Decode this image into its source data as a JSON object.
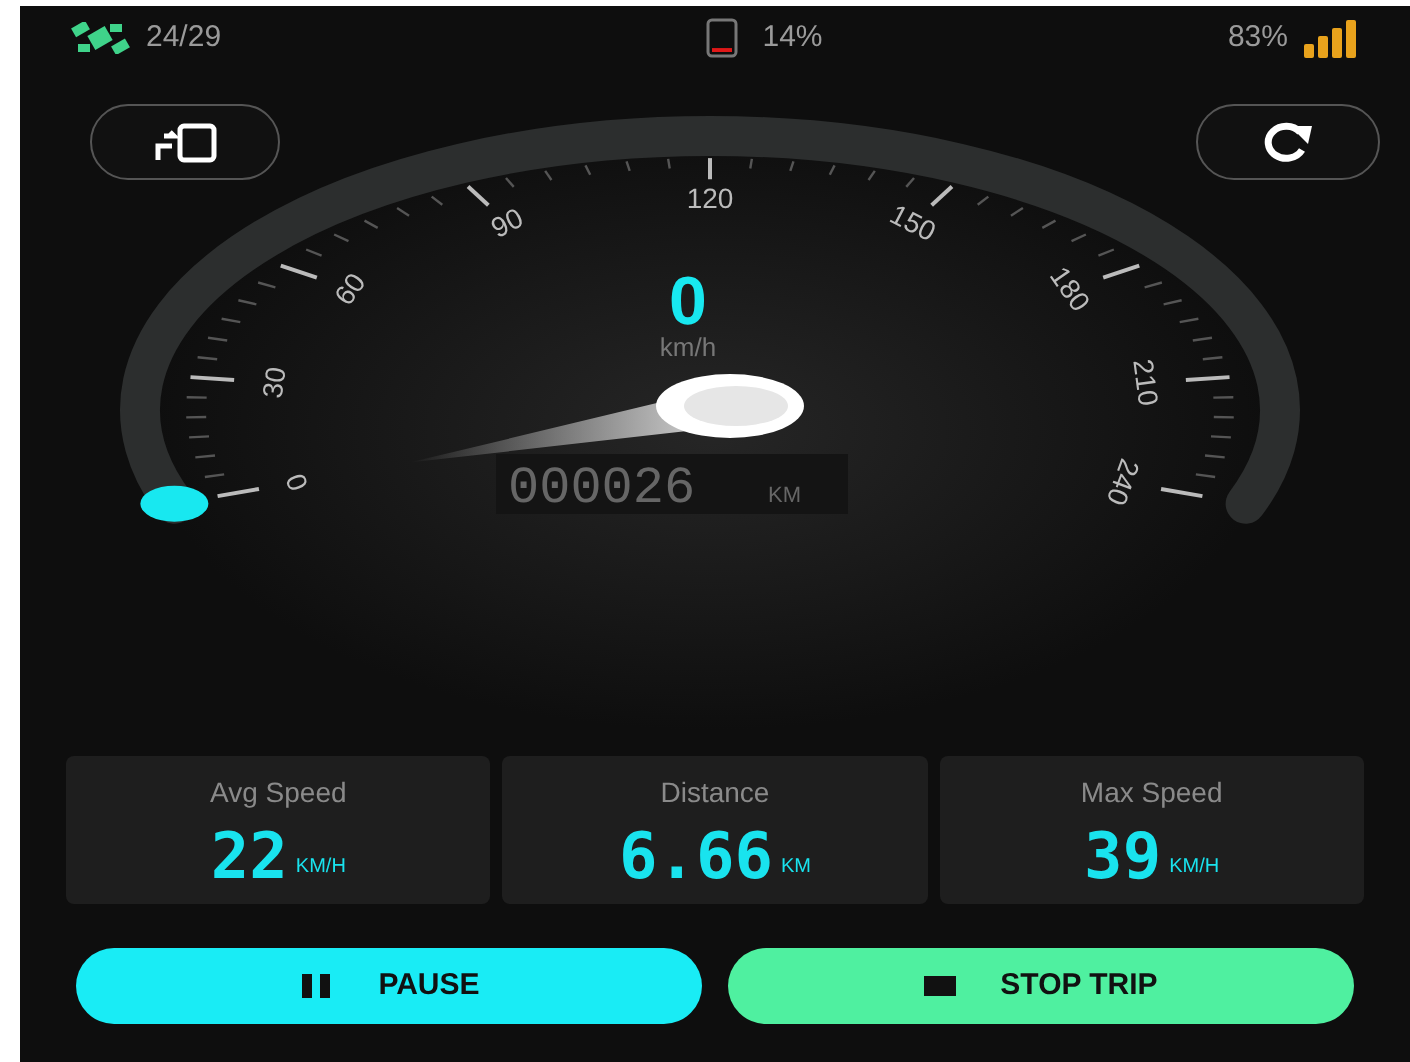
{
  "status_bar": {
    "satellites": "24/29",
    "battery": {
      "text": "14%",
      "level": 0.14
    },
    "signal": "83%"
  },
  "gauge": {
    "scale_labels": [
      "0",
      "30",
      "60",
      "90",
      "120",
      "150",
      "180",
      "210",
      "240"
    ],
    "speed": "0",
    "unit": "km/h",
    "odometer": "000026",
    "odometer_unit": "KM"
  },
  "stats": [
    {
      "label": "Avg Speed",
      "value": "22",
      "unit": "KM/H"
    },
    {
      "label": "Distance",
      "value": "6.66",
      "unit": "KM"
    },
    {
      "label": "Max Speed",
      "value": "39",
      "unit": "KM/H"
    }
  ],
  "buttons": [
    {
      "label": "PAUSE",
      "kind": "pause"
    },
    {
      "label": "STOP TRIP",
      "kind": "stop"
    }
  ]
}
